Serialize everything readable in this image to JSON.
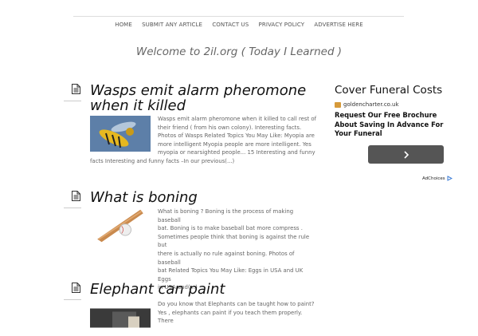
{
  "nav": {
    "items": [
      "HOME",
      "SUBMIT ANY ARTICLE",
      "CONTACT US",
      "PRIVACY POLICY",
      "ADVERTISE HERE"
    ]
  },
  "tagline": "Welcome to 2il.org ( Today I Learned )",
  "posts": [
    {
      "title": "Wasps emit alarm pheromone when it killed",
      "lines": [
        "Wasps emit alarm pheromone when it killed to call rest of",
        "their friend ( from his own colony). Interesting facts.",
        "Photos of  Wasps Related Topics You May Like: Myopia are",
        "more intelligent Myopia people are more intelligent. Yes",
        "myopia or nearsighted people... 15 Interesting and funny",
        "facts Interesting and funny facts –In our previous(...)"
      ]
    },
    {
      "title": "What is boning",
      "lines": [
        "What is boning ? Boning is the process of making baseball",
        "bat. Boning is to make baseball bat  more compress .",
        "Sometimes people think that boning is against the rule but",
        "there is actually no rule against boning. Photos of baseball",
        "bat   Related Topics You May Like: Eggs in USA and UK Eggs",
        "in USA and(...)"
      ]
    },
    {
      "title": "Elephant can paint",
      "lines": [
        "Do you know that Elephants can be taught how to paint?",
        "Yes , elephants can paint if you teach them properly. There"
      ]
    }
  ],
  "ad": {
    "title": "Cover Funeral Costs",
    "domain": "goldencharter.co.uk",
    "body": "Request Our Free Brochure About Saving In Advance For Your Funeral",
    "adchoices": "AdChoices"
  }
}
